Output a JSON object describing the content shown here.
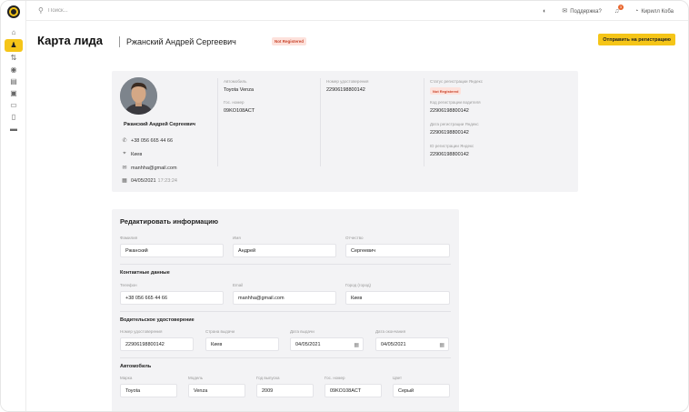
{
  "topbar": {
    "search_placeholder": "Поиск...",
    "support_label": "Поддержка?",
    "notifications_count": "3",
    "user_name": "Кирилл Коба"
  },
  "header": {
    "title": "Карта лида",
    "person_name": "Ржанский Андрей Сергеевич",
    "status": "Not Registered",
    "send_button": "Отправить на регистрацию"
  },
  "lead": {
    "name": "Ржанский Андрей Сергеевич",
    "phone": "+38 056 665 44 66",
    "city": "Киев",
    "email": "manhha@gmail.com",
    "date": "04/05/2021",
    "time": "17:23:24",
    "car_label": "Автомобиль",
    "car_value": "Toyota Venza",
    "plate_label": "Гос. номер",
    "plate_value": "09KO108ACT",
    "license_label": "Номер удостоверения",
    "license_value": "22906198800142",
    "reg_status_label": "Статус регистрации Яндекс",
    "reg_status_value": "Not Registered",
    "driver_code_label": "Код регистрации водителя",
    "driver_code_value": "22906198800142",
    "reg_date_label": "Дата регистрации Яндекс",
    "reg_date_value": "22906198800142",
    "id_label": "ID регистрации Яндекс",
    "id_value": "22906198800142"
  },
  "form": {
    "title": "Редактировать информацию",
    "personal": {
      "surname_label": "Фамилия",
      "surname": "Ржанский",
      "name_label": "Имя",
      "name": "Андрей",
      "patronymic_label": "Отчество",
      "patronymic": "Сергеевич"
    },
    "contacts": {
      "title": "Контактные данные",
      "phone_label": "Телефон",
      "phone": "+38 056 665 44 66",
      "email_label": "Email",
      "email": "manhha@gmail.com",
      "city_label": "Город (город)",
      "city": "Киев"
    },
    "license": {
      "title": "Водительское удостоверение",
      "number_label": "Номер удостоверения",
      "number": "22906198800142",
      "country_label": "Страна выдачи",
      "country": "Киев",
      "issue_label": "Дата выдачи",
      "issue": "04/05/2021",
      "expiry_label": "Дата окончания",
      "expiry": "04/05/2021"
    },
    "car": {
      "title": "Автомобиль",
      "brand_label": "Марка",
      "brand": "Toyota",
      "model_label": "Модель",
      "model": "Venza",
      "year_label": "Год выпуска",
      "year": "2009",
      "plate_label": "Гос. номер",
      "plate": "09KO108ACT",
      "color_label": "Цвет",
      "color": "Серый"
    }
  },
  "colors": {
    "accent": "#f5c518",
    "danger": "#c9442b",
    "card_bg": "#f3f3f5"
  }
}
